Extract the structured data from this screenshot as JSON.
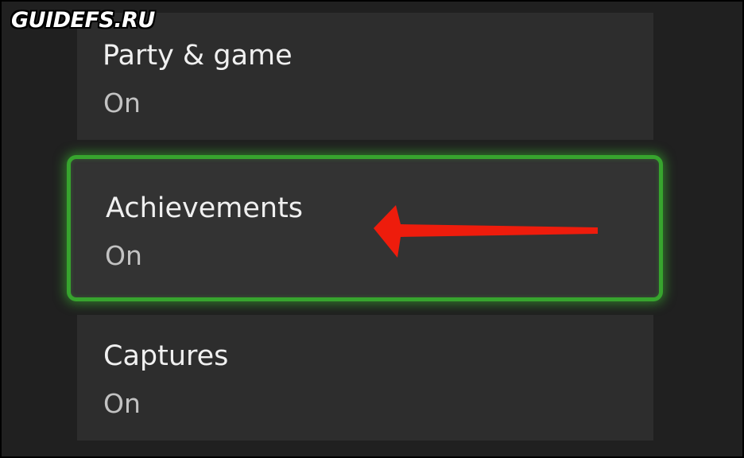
{
  "watermark": "GUIDEFS.RU",
  "settings": {
    "items": [
      {
        "label": "Party & game",
        "value": "On"
      },
      {
        "label": "Achievements",
        "value": "On"
      },
      {
        "label": "Captures",
        "value": "On"
      }
    ],
    "focused_item": "Achievements"
  },
  "colors": {
    "background": "#202020",
    "tile": "#2d2d2d",
    "tile_focused": "#333333",
    "focus_border": "#37a42e",
    "label_text": "#f0f0f0",
    "value_text": "#c2c2c2",
    "annotation_arrow": "#ee1c0c"
  },
  "icons": {
    "annotation": "red-arrow-icon"
  }
}
